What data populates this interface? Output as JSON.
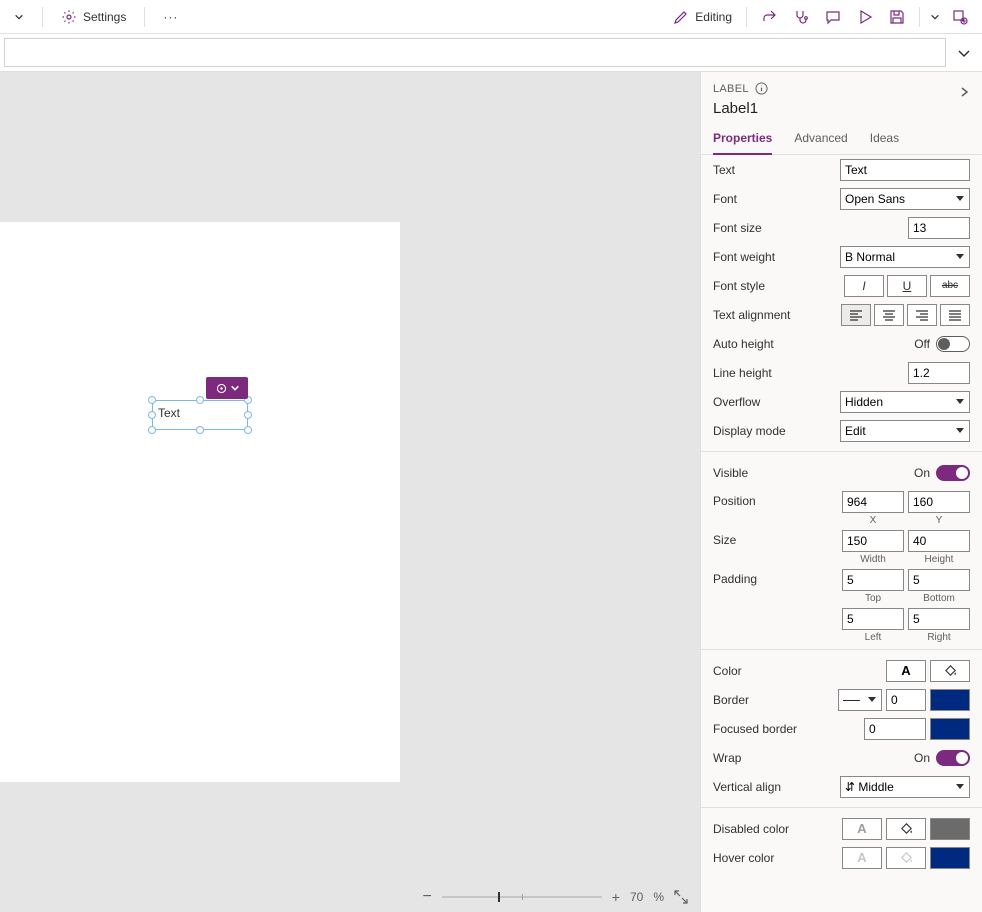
{
  "topbar": {
    "settings_label": "Settings",
    "editing_label": "Editing"
  },
  "zoom": {
    "value": "70",
    "unit": "%"
  },
  "panel": {
    "type_label": "LABEL",
    "control_name": "Label1"
  },
  "tabs": {
    "properties": "Properties",
    "advanced": "Advanced",
    "ideas": "Ideas"
  },
  "canvas": {
    "selected_text": "Text"
  },
  "props": {
    "text": {
      "label": "Text",
      "value": "Text"
    },
    "font": {
      "label": "Font",
      "value": "Open Sans"
    },
    "fontsize": {
      "label": "Font size",
      "value": "13"
    },
    "fontweight": {
      "label": "Font weight",
      "value": "Normal"
    },
    "fontstyle": {
      "label": "Font style"
    },
    "textalign": {
      "label": "Text alignment"
    },
    "autoheight": {
      "label": "Auto height",
      "state": "Off"
    },
    "lineheight": {
      "label": "Line height",
      "value": "1.2"
    },
    "overflow": {
      "label": "Overflow",
      "value": "Hidden"
    },
    "displaymode": {
      "label": "Display mode",
      "value": "Edit"
    },
    "visible": {
      "label": "Visible",
      "state": "On"
    },
    "position": {
      "label": "Position",
      "x": "964",
      "y": "160",
      "xlbl": "X",
      "ylbl": "Y"
    },
    "size": {
      "label": "Size",
      "w": "150",
      "h": "40",
      "wlbl": "Width",
      "hlbl": "Height"
    },
    "padding": {
      "label": "Padding",
      "top": "5",
      "bottom": "5",
      "left": "5",
      "right": "5",
      "toplbl": "Top",
      "bottomlbl": "Bottom",
      "leftlbl": "Left",
      "rightlbl": "Right"
    },
    "color": {
      "label": "Color"
    },
    "border": {
      "label": "Border",
      "width": "0"
    },
    "focusedborder": {
      "label": "Focused border",
      "width": "0"
    },
    "wrap": {
      "label": "Wrap",
      "state": "On"
    },
    "valign": {
      "label": "Vertical align",
      "value": "Middle"
    },
    "disabledcolor": {
      "label": "Disabled color"
    },
    "hovercolor": {
      "label": "Hover color"
    }
  },
  "colors": {
    "darkblue": "#002a80",
    "gray": "#6b6b6b",
    "purple": "#7b2a7d"
  }
}
